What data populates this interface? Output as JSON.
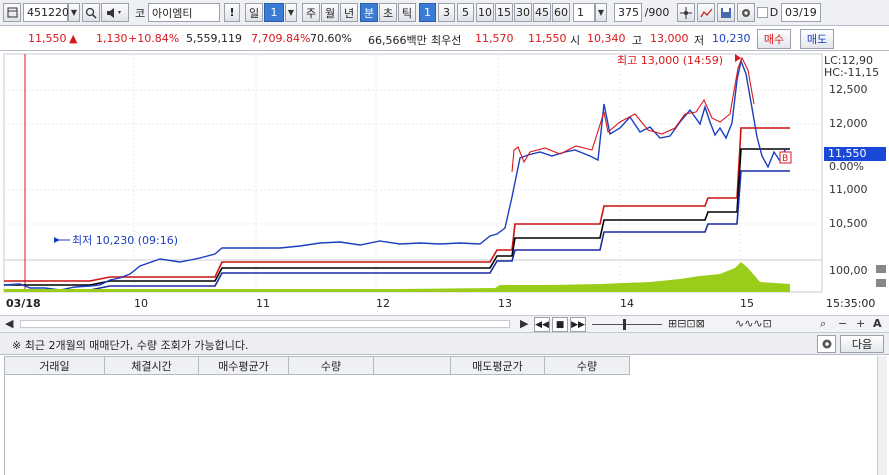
{
  "toolbar": {
    "code": "451220",
    "market_tag": "코",
    "stock_name": "아이엠티",
    "alert_btn": "!",
    "period_day": "일",
    "period_day_n": "1",
    "period_week": "주",
    "period_month": "월",
    "period_year": "년",
    "period_min": "분",
    "period_sec": "초",
    "period_tick": "틱",
    "intervals": [
      "1",
      "3",
      "5",
      "10",
      "15",
      "30",
      "45",
      "60"
    ],
    "interval_value": "1",
    "count": "375",
    "count_max": "/900",
    "date_checkbox_label": "D",
    "date_value": "03/19"
  },
  "quote": {
    "price": "11,550",
    "change": "1,130",
    "change_pct": "+10.84%",
    "volume": "5,559,119",
    "volume_ratio": "7,709.84%",
    "turnover_ratio": "70.60%",
    "amount": "66,566백만",
    "best_label": "최우선",
    "ask": "11,570",
    "bid": "11,550",
    "open_label": "시",
    "open": "10,340",
    "high_label": "고",
    "high": "13,000",
    "low_label": "저",
    "low": "10,230",
    "buy_btn": "매수",
    "sell_btn": "매도"
  },
  "chart": {
    "lc_label": "LC:12,90",
    "hc_label": "HC:-11,15",
    "high_annot": "최고 13,000 (14:59)",
    "low_annot": "최저 10,230 (09:16)",
    "price_ticks": [
      "12,500",
      "12,000",
      "11,000",
      "10,500"
    ],
    "current_price_label": "11,550",
    "current_pct": "0.00%",
    "volume_tick": "100,00",
    "date_start": "03/18",
    "date_labels": [
      "10",
      "11",
      "12",
      "13",
      "14",
      "15"
    ],
    "time_end": "15:35:00",
    "colors": {
      "up": "#d8181c",
      "down": "#1a3fc0",
      "volume": "#9acd1a",
      "band_upper": "#cc1111",
      "band_mid": "#000000",
      "band_lower": "#1a2aa0",
      "current_marker": "#1a49d8"
    }
  },
  "notice": {
    "text": "※ 최근 2개월의 매매단가, 수량 조회가 가능합니다.",
    "next_btn": "다음"
  },
  "table": {
    "headers": [
      "거래일",
      "체결시간",
      "매수평균가",
      "수량",
      "",
      "매도평균가",
      "수량"
    ]
  }
}
